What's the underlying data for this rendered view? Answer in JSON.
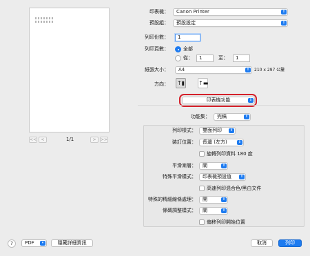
{
  "preview": {
    "page_current": "1/1",
    "nav": [
      "<<",
      "<",
      ">",
      ">>"
    ]
  },
  "top": {
    "printer_label": "印表機：",
    "printer_value": "Canon Printer",
    "presets_label": "預設組：",
    "presets_value": "預設設定",
    "copies_label": "列印份數：",
    "copies_value": "1",
    "pages_label": "列印頁數：",
    "pages_all": "全部",
    "pages_from": "從：",
    "pages_from_value": "1",
    "pages_to": "至：",
    "pages_to_value": "1",
    "paper_label": "紙張大小：",
    "paper_value": "A4",
    "paper_dims": "210 x 297 公釐",
    "orientation_label": "方向："
  },
  "panel": {
    "value": "印表機功能"
  },
  "featureset": {
    "label": "功能集：",
    "value": "完稿"
  },
  "options": {
    "print_style_label": "列印樣式：",
    "print_style_value": "雙面列印",
    "binding_label": "裝訂位置：",
    "binding_value": "長邊 (左方)",
    "rotate_label": "旋轉列印資料 180 度",
    "smoothing_label": "平滑漸層：",
    "smoothing_value": "關",
    "special_smoothing_label": "特殊平滑模式：",
    "special_smoothing_value": "印表機預設值",
    "highspeed_label": "高速列印混合色/黑白文件",
    "thinline_label": "特殊的精細線條處理：",
    "thinline_value": "開",
    "barcode_label": "條碼調整模式：",
    "barcode_value": "關",
    "offset_label": "偏移列印開始位置"
  },
  "footer": {
    "help": "?",
    "pdf": "PDF",
    "hide_details": "隱藏詳細資訊",
    "cancel": "取消",
    "print": "列印"
  },
  "colors": {
    "accent": "#1d7bf0",
    "highlight": "#d4202a"
  }
}
